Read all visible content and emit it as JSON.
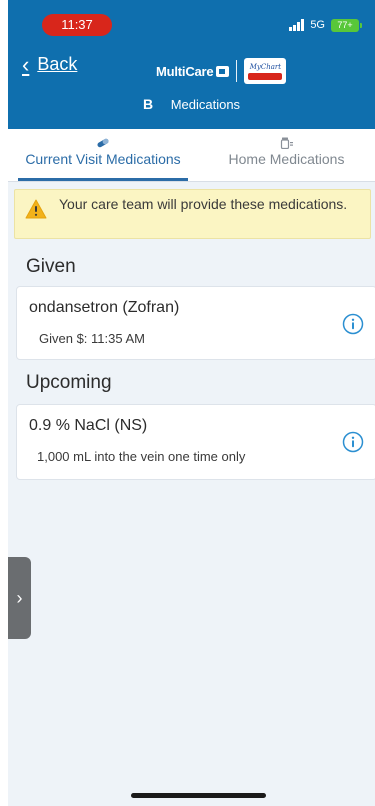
{
  "status_bar": {
    "time": "11:37",
    "network": "5G",
    "battery": "77+"
  },
  "header": {
    "back_label": "Back",
    "brand_name": "MultiCare",
    "partner_logo": "MyChart",
    "subtitle_icon": "B",
    "subtitle": "Medications"
  },
  "tabs": [
    {
      "label": "Current Visit Medications",
      "icon": "pill-icon",
      "active": true
    },
    {
      "label": "Home Medications",
      "icon": "bottle-icon",
      "active": false
    }
  ],
  "alert": {
    "text": "Your care team will provide these medications."
  },
  "sections": {
    "given": {
      "title": "Given",
      "items": [
        {
          "name": "ondansetron (Zofran)",
          "detail": "Given $: 11:35 AM"
        }
      ]
    },
    "upcoming": {
      "title": "Upcoming",
      "items": [
        {
          "name": "0.9 % NaCl (NS)",
          "detail": "1,000 mL into the vein one time only"
        }
      ]
    }
  },
  "colors": {
    "header_bg": "#0f6fae",
    "accent": "#2b6ca7",
    "alert_bg": "#fbf5c3",
    "page_bg": "#eef3f8",
    "time_pill": "#d8261b"
  }
}
